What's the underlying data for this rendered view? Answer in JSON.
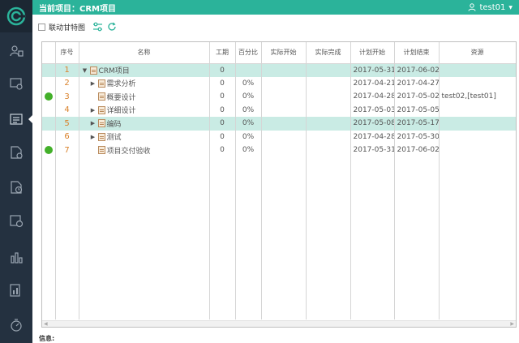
{
  "header": {
    "title": "当前项目：CRM项目",
    "user": "test01"
  },
  "toolbar": {
    "link_gantt_label": "联动甘特图"
  },
  "sidebar": {
    "items": [
      {
        "icon": "users-icon"
      },
      {
        "icon": "project-screen-icon"
      },
      {
        "icon": "task-list-icon"
      },
      {
        "icon": "document-icon"
      },
      {
        "icon": "clock-icon"
      },
      {
        "icon": "timesheet-icon"
      },
      {
        "icon": "statistics-icon"
      },
      {
        "icon": "report-icon"
      },
      {
        "icon": "timer-icon"
      }
    ],
    "active_index": 2
  },
  "table": {
    "headers": [
      "序号",
      "名称",
      "工期",
      "百分比",
      "实际开始",
      "实际完成",
      "计划开始",
      "计划结束",
      "资源"
    ],
    "rows": [
      {
        "seq": "1",
        "name": "CRM项目",
        "duration": "0",
        "percent": "",
        "actual_start": "",
        "actual_end": "",
        "plan_start": "2017-05-31",
        "plan_end": "2017-06-02",
        "resource": "",
        "indicator": false,
        "level": 0,
        "expander": "down",
        "highlight": true
      },
      {
        "seq": "2",
        "name": "需求分析",
        "duration": "0",
        "percent": "0%",
        "actual_start": "",
        "actual_end": "",
        "plan_start": "2017-04-21",
        "plan_end": "2017-04-27",
        "resource": "",
        "indicator": false,
        "level": 1,
        "expander": "right",
        "highlight": false
      },
      {
        "seq": "3",
        "name": "概要设计",
        "duration": "0",
        "percent": "0%",
        "actual_start": "",
        "actual_end": "",
        "plan_start": "2017-04-28",
        "plan_end": "2017-05-02",
        "resource": "test02,[test01]",
        "indicator": true,
        "level": 1,
        "expander": "",
        "highlight": false
      },
      {
        "seq": "4",
        "name": "详细设计",
        "duration": "0",
        "percent": "0%",
        "actual_start": "",
        "actual_end": "",
        "plan_start": "2017-05-03",
        "plan_end": "2017-05-05",
        "resource": "",
        "indicator": false,
        "level": 1,
        "expander": "right",
        "highlight": false
      },
      {
        "seq": "5",
        "name": "编码",
        "duration": "0",
        "percent": "0%",
        "actual_start": "",
        "actual_end": "",
        "plan_start": "2017-05-08",
        "plan_end": "2017-05-17",
        "resource": "",
        "indicator": false,
        "level": 1,
        "expander": "right",
        "highlight": true
      },
      {
        "seq": "6",
        "name": "测试",
        "duration": "0",
        "percent": "0%",
        "actual_start": "",
        "actual_end": "",
        "plan_start": "2017-04-28",
        "plan_end": "2017-05-30",
        "resource": "",
        "indicator": false,
        "level": 1,
        "expander": "right",
        "highlight": false
      },
      {
        "seq": "7",
        "name": "项目交付验收",
        "duration": "0",
        "percent": "0%",
        "actual_start": "",
        "actual_end": "",
        "plan_start": "2017-05-31",
        "plan_end": "2017-06-02",
        "resource": "",
        "indicator": true,
        "level": 1,
        "expander": "",
        "highlight": false
      }
    ]
  },
  "footer": {
    "info_label": "信息:"
  },
  "colors": {
    "accent": "#2bb39a",
    "sidebar": "#243140",
    "highlight_row": "#c9ebe4",
    "seq_number": "#d9822b",
    "indicator": "#43b02a"
  }
}
